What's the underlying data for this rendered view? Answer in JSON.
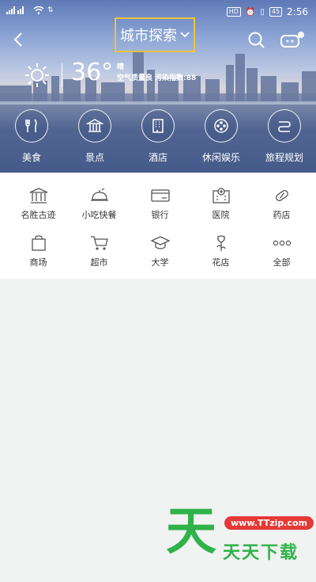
{
  "status": {
    "time": "2:56",
    "hd": "HD",
    "battery": "45"
  },
  "header": {
    "title": "城市探索"
  },
  "weather": {
    "temperature": "36°",
    "condition": "晴",
    "air_quality": "空气质量良 污染指数:88"
  },
  "categories": [
    {
      "label": "美食",
      "icon": "fork-knife-icon"
    },
    {
      "label": "景点",
      "icon": "landmark-icon"
    },
    {
      "label": "酒店",
      "icon": "building-icon"
    },
    {
      "label": "休闲娱乐",
      "icon": "film-reel-icon"
    },
    {
      "label": "旅程规划",
      "icon": "route-icon"
    }
  ],
  "services": [
    {
      "label": "名胜古迹",
      "icon": "temple-icon"
    },
    {
      "label": "小吃快餐",
      "icon": "food-cloche-icon"
    },
    {
      "label": "银行",
      "icon": "bank-card-icon"
    },
    {
      "label": "医院",
      "icon": "hospital-icon"
    },
    {
      "label": "药店",
      "icon": "pill-icon"
    },
    {
      "label": "商场",
      "icon": "shopping-bag-icon"
    },
    {
      "label": "超市",
      "icon": "cart-icon"
    },
    {
      "label": "大学",
      "icon": "graduation-cap-icon"
    },
    {
      "label": "花店",
      "icon": "flower-icon"
    },
    {
      "label": "全部",
      "icon": "more-dots-icon"
    }
  ],
  "watermark": {
    "glyph": "天",
    "url": "www.TTzip.com",
    "text": "天天下载"
  },
  "colors": {
    "accent_frame": "#f0c43a",
    "watermark_green": "#2fb24a",
    "watermark_red": "#e53935"
  }
}
